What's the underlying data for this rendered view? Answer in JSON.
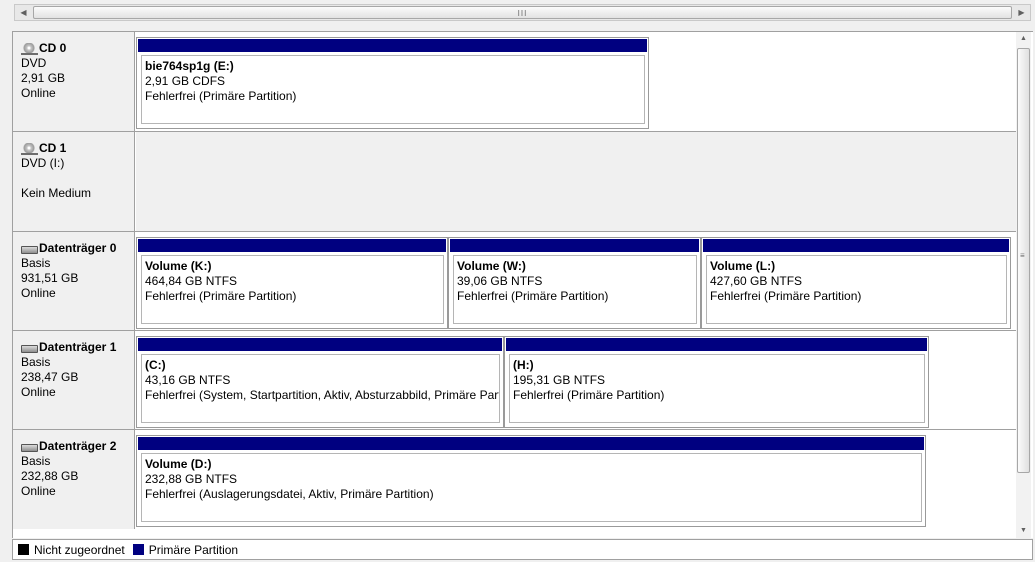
{
  "colors": {
    "primary_partition": "#000080",
    "unallocated": "#000000"
  },
  "scrollbar": {
    "grip": "III"
  },
  "disks": [
    {
      "icon": "cd-drive-icon",
      "title": "CD 0",
      "line1": "DVD",
      "line2": "2,91 GB",
      "line3": "Online",
      "partitions": [
        {
          "name": "bie764sp1g  (E:)",
          "size": "2,91 GB CDFS",
          "status": "Fehlerfrei (Primäre Partition)"
        }
      ]
    },
    {
      "icon": "cd-drive-icon",
      "title": "CD 1",
      "line1": "DVD (I:)",
      "line2": "",
      "line3": "Kein Medium",
      "partitions": []
    },
    {
      "icon": "hard-disk-icon",
      "title": "Datenträger 0",
      "line1": "Basis",
      "line2": "931,51 GB",
      "line3": "Online",
      "partitions": [
        {
          "name": "Volume  (K:)",
          "size": "464,84 GB NTFS",
          "status": "Fehlerfrei (Primäre Partition)"
        },
        {
          "name": "Volume  (W:)",
          "size": "39,06 GB NTFS",
          "status": "Fehlerfrei (Primäre Partition)"
        },
        {
          "name": "Volume  (L:)",
          "size": "427,60 GB NTFS",
          "status": "Fehlerfrei (Primäre Partition)"
        }
      ]
    },
    {
      "icon": "hard-disk-icon",
      "title": "Datenträger 1",
      "line1": "Basis",
      "line2": "238,47 GB",
      "line3": "Online",
      "partitions": [
        {
          "name": "  (C:)",
          "size": "43,16 GB NTFS",
          "status": "Fehlerfrei (System, Startpartition, Aktiv, Absturzabbild, Primäre Part"
        },
        {
          "name": "  (H:)",
          "size": "195,31 GB NTFS",
          "status": "Fehlerfrei (Primäre Partition)"
        }
      ]
    },
    {
      "icon": "hard-disk-icon",
      "title": "Datenträger 2",
      "line1": "Basis",
      "line2": "232,88 GB",
      "line3": "Online",
      "partitions": [
        {
          "name": "Volume  (D:)",
          "size": "232,88 GB NTFS",
          "status": "Fehlerfrei (Auslagerungsdatei, Aktiv, Primäre Partition)"
        }
      ]
    }
  ],
  "legend": {
    "unallocated_label": "Nicht zugeordnet",
    "primary_label": "Primäre Partition"
  }
}
